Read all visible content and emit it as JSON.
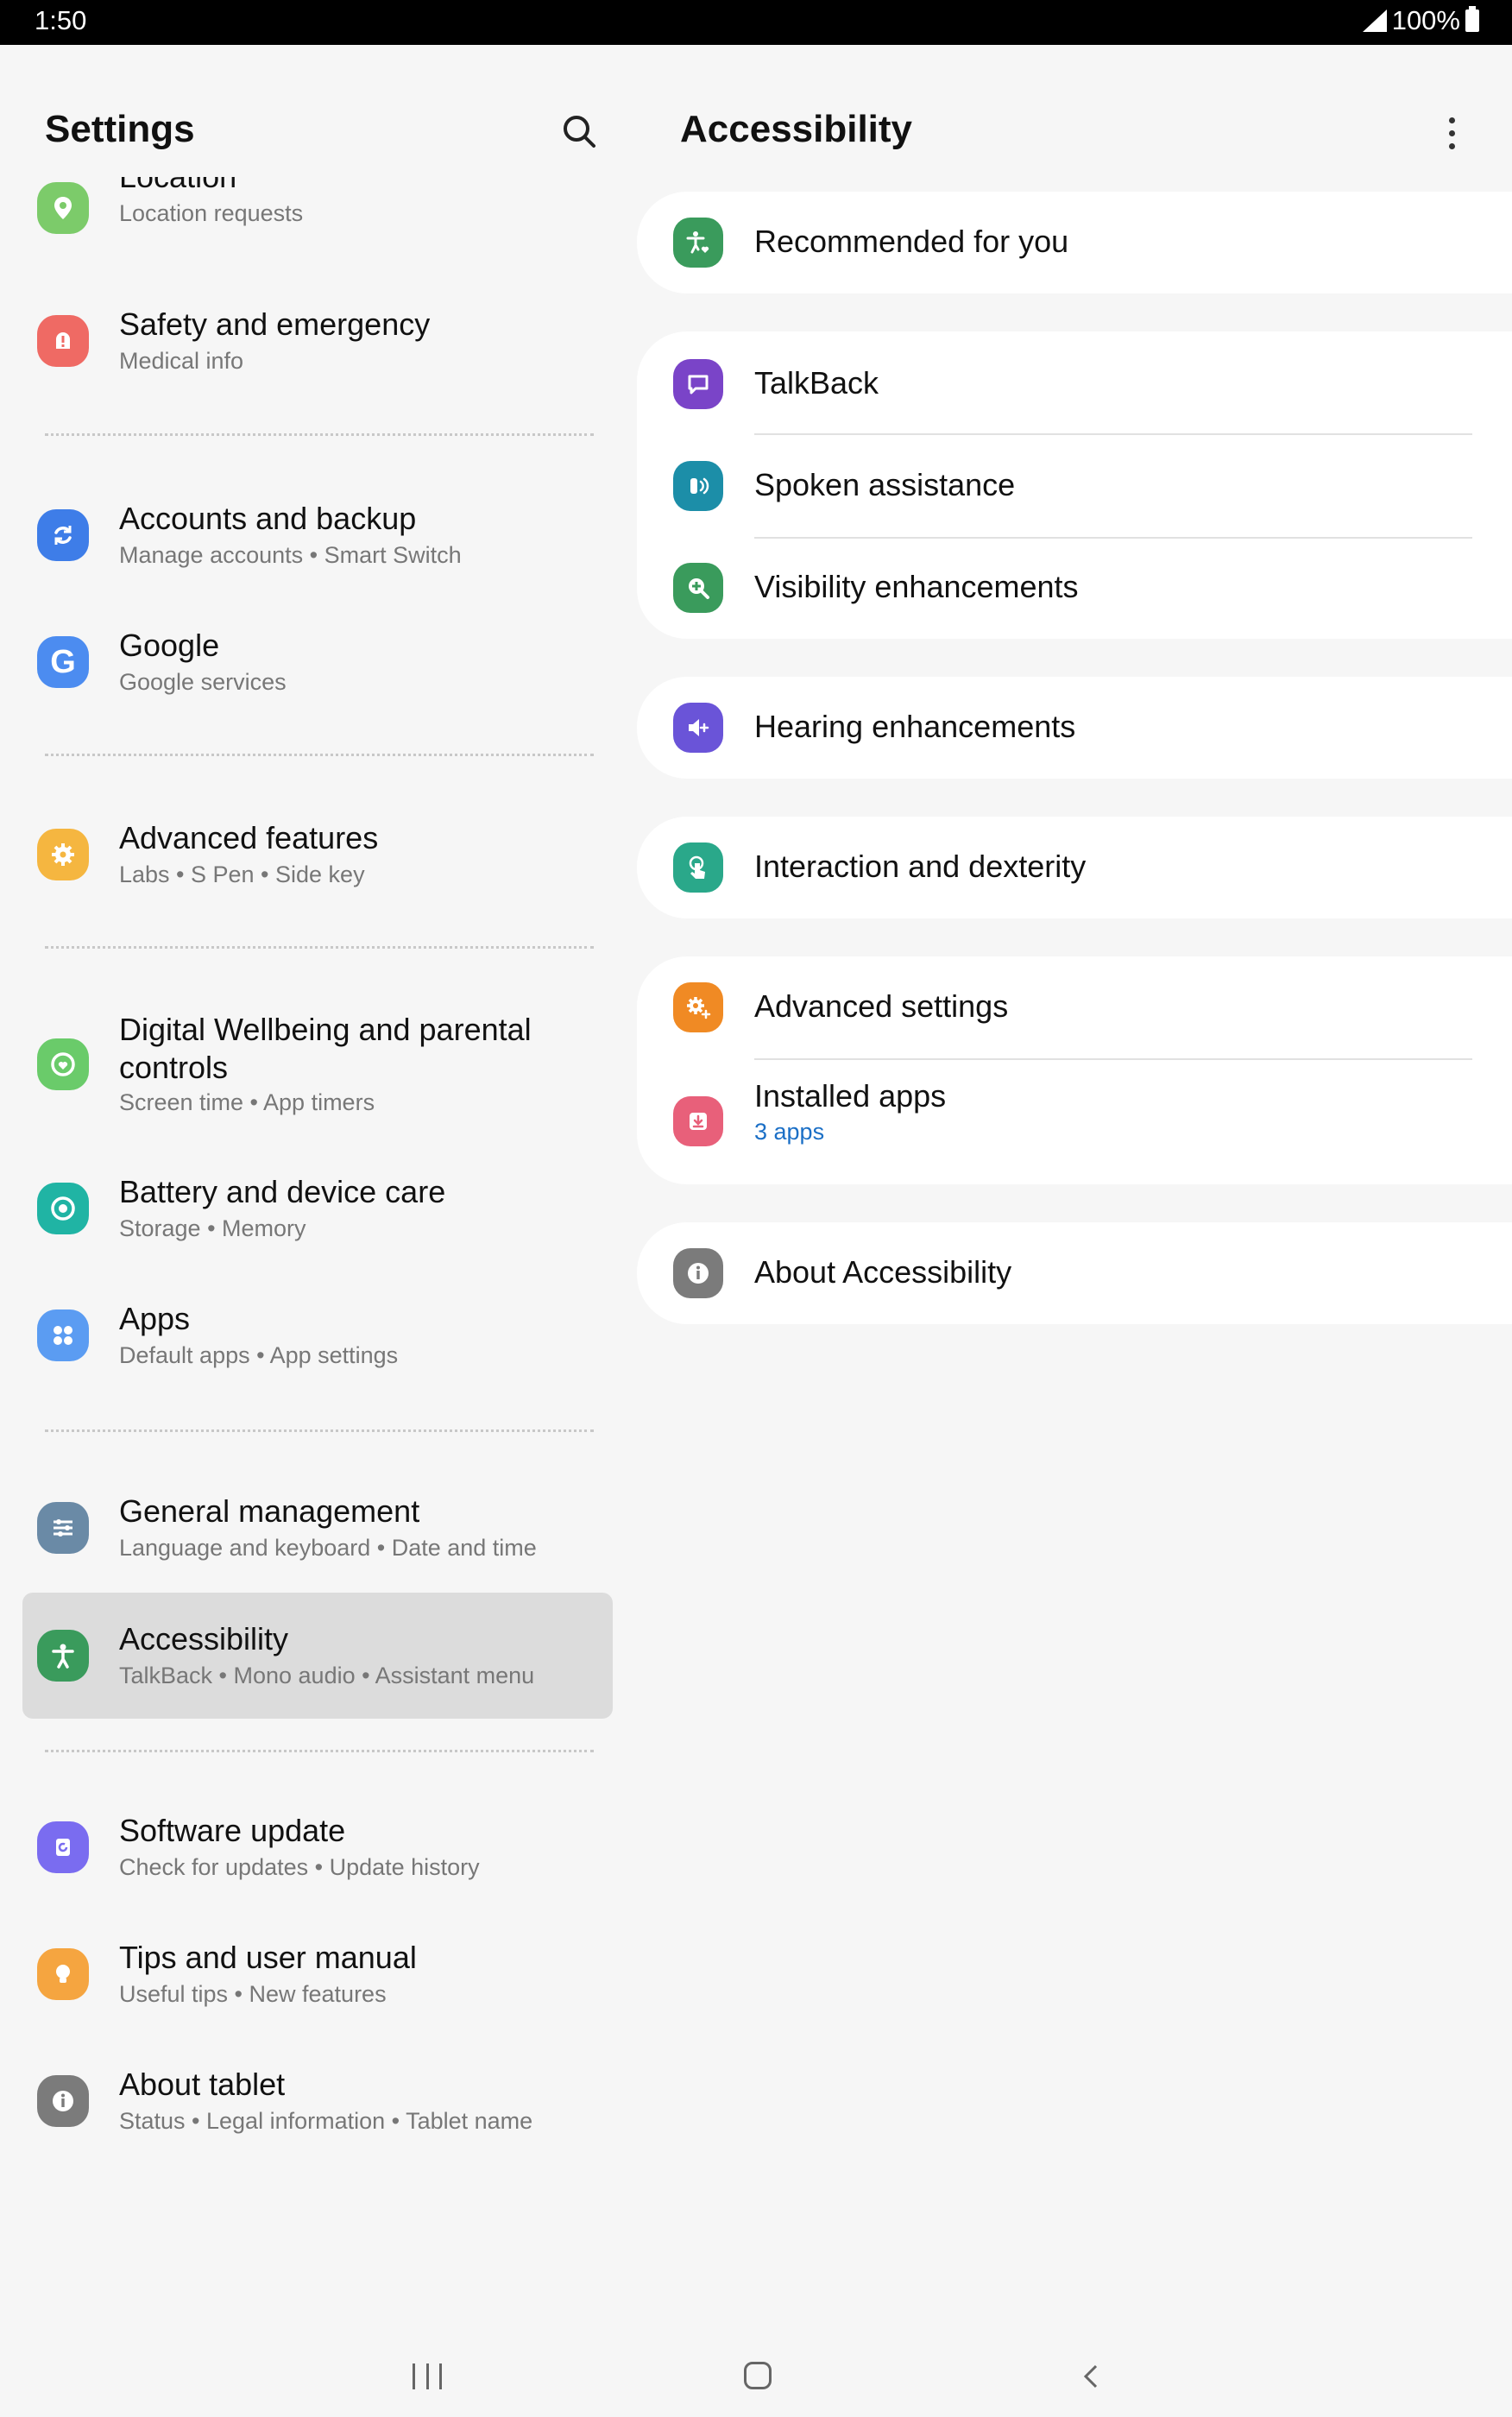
{
  "status_bar": {
    "time": "1:50",
    "battery": "100%"
  },
  "left_pane": {
    "title": "Settings",
    "items": [
      {
        "title": "Location",
        "subtitle": "Location requests",
        "icon": "location-pin-icon",
        "color": "#7ccb6a"
      },
      {
        "title": "Safety and emergency",
        "subtitle": "Medical info",
        "icon": "emergency-alert-icon",
        "color": "#ef6a64"
      },
      {
        "title": "Accounts and backup",
        "subtitle": "Manage accounts  •  Smart Switch",
        "icon": "sync-icon",
        "color": "#3e7de8"
      },
      {
        "title": "Google",
        "subtitle": "Google services",
        "icon": "google-g-icon",
        "color": "#4c8cf0"
      },
      {
        "title": "Advanced features",
        "subtitle": "Labs  •  S Pen  •  Side key",
        "icon": "gear-plus-icon",
        "color": "#f5b640"
      },
      {
        "title": "Digital Wellbeing and parental controls",
        "subtitle": "Screen time  •  App timers",
        "icon": "wellbeing-heart-icon",
        "color": "#6acb6a"
      },
      {
        "title": "Battery and device care",
        "subtitle": "Storage  •  Memory",
        "icon": "device-care-icon",
        "color": "#20b4a4"
      },
      {
        "title": "Apps",
        "subtitle": "Default apps  •  App settings",
        "icon": "apps-grid-icon",
        "color": "#5b9cf2"
      },
      {
        "title": "General management",
        "subtitle": "Language and keyboard  •  Date and time",
        "icon": "sliders-icon",
        "color": "#6a8aa6"
      },
      {
        "title": "Accessibility",
        "subtitle": "TalkBack  •  Mono audio  •  Assistant menu",
        "icon": "accessibility-person-icon",
        "color": "#3a9b5c"
      },
      {
        "title": "Software update",
        "subtitle": "Check for updates  •  Update history",
        "icon": "software-update-icon",
        "color": "#7a6cf0"
      },
      {
        "title": "Tips and user manual",
        "subtitle": "Useful tips  •  New features",
        "icon": "lightbulb-icon",
        "color": "#f5a540"
      },
      {
        "title": "About tablet",
        "subtitle": "Status  •  Legal information  •  Tablet name",
        "icon": "info-icon",
        "color": "#7b7b7b"
      }
    ]
  },
  "right_pane": {
    "title": "Accessibility",
    "items": [
      {
        "title": "Recommended for you",
        "icon": "accessibility-heart-icon",
        "color": "#3a9b5c"
      },
      {
        "title": "TalkBack",
        "icon": "talkback-icon",
        "color": "#7a44c8"
      },
      {
        "title": "Spoken assistance",
        "icon": "spoken-assistance-icon",
        "color": "#1c8ea8"
      },
      {
        "title": "Visibility enhancements",
        "icon": "magnifier-plus-icon",
        "color": "#3a9b5c"
      },
      {
        "title": "Hearing enhancements",
        "icon": "speaker-plus-icon",
        "color": "#6a54d8"
      },
      {
        "title": "Interaction and dexterity",
        "icon": "touch-hand-icon",
        "color": "#2aa88a"
      },
      {
        "title": "Advanced settings",
        "icon": "gear-plus-icon",
        "color": "#f08a24"
      },
      {
        "title": "Installed apps",
        "subtitle": "3 apps",
        "icon": "download-box-icon",
        "color": "#e8607a"
      },
      {
        "title": "About Accessibility",
        "icon": "info-icon",
        "color": "#7b7b7b"
      }
    ]
  }
}
